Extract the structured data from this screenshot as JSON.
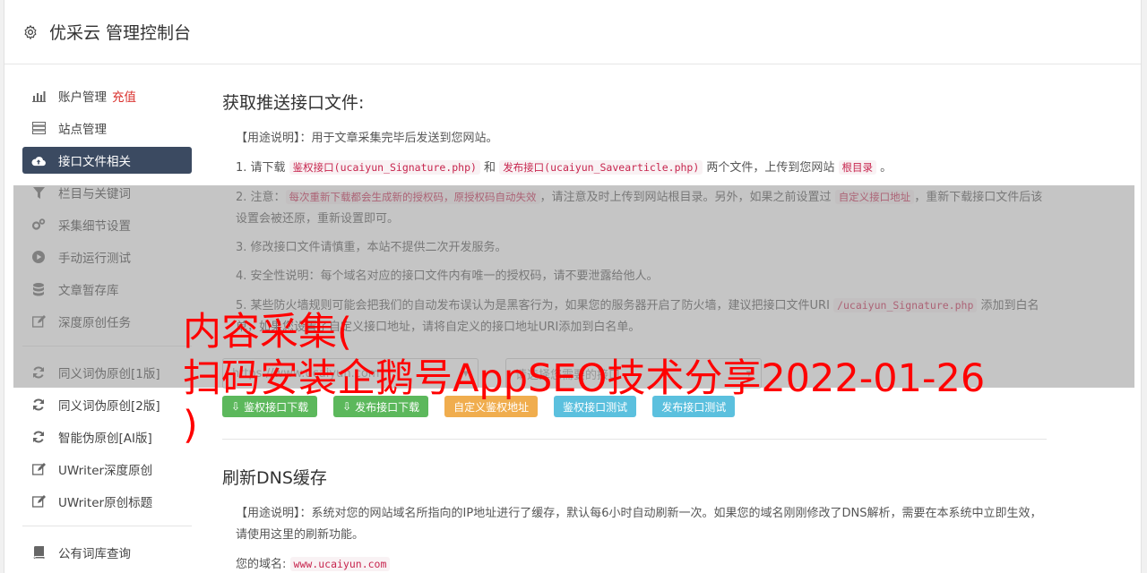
{
  "header": {
    "title": "优采云 管理控制台",
    "icon": "gear-icon"
  },
  "sidebar": {
    "group1": [
      {
        "label": "账户管理",
        "extra": "充值",
        "icon": "bar-chart-icon"
      },
      {
        "label": "站点管理",
        "icon": "server-icon"
      },
      {
        "label": "接口文件相关",
        "icon": "cloud-upload-icon",
        "active": true
      },
      {
        "label": "栏目与关键词",
        "icon": "filter-icon"
      },
      {
        "label": "采集细节设置",
        "icon": "cogs-icon"
      },
      {
        "label": "手动运行测试",
        "icon": "play-circle-icon"
      },
      {
        "label": "文章暂存库",
        "icon": "database-icon"
      },
      {
        "label": "深度原创任务",
        "icon": "edit-icon"
      }
    ],
    "group2": [
      {
        "label": "同义词伪原创[1版]",
        "icon": "refresh-icon"
      },
      {
        "label": "同义词伪原创[2版]",
        "icon": "refresh-icon"
      },
      {
        "label": "智能伪原创[AI版]",
        "icon": "refresh-icon"
      },
      {
        "label": "UWriter深度原创",
        "icon": "edit-icon"
      },
      {
        "label": "UWriter原创标题",
        "icon": "edit-icon"
      }
    ],
    "group3": [
      {
        "label": "公有词库查询",
        "icon": "book-icon"
      }
    ]
  },
  "interface": {
    "title": "获取推送接口文件:",
    "usage_label": "【用途说明】",
    "usage_text": "：用于文章采集完毕后发送到您网站。",
    "item1": {
      "prefix": "1. 请下载 ",
      "code1": "鉴权接口(ucaiyun_Signature.php)",
      "mid1": " 和 ",
      "code2": "发布接口(ucaiyun_Savearticle.php)",
      "mid2": " 两个文件，上传到您网站 ",
      "code3": "根目录",
      "suffix": " 。"
    },
    "item2": {
      "prefix": "2. 注意：",
      "code1": "每次重新下载都会生成新的授权码，原授权码自动失效",
      "mid": "，请注意及时上传到网站根目录。另外，如果之前设置过 ",
      "code2": "自定义接口地址",
      "suffix": "，重新下载接口文件后该设置会被还原，重新设置即可。"
    },
    "item3": "3. 修改接口文件请慎重，本站不提供二次开发服务。",
    "item4": "4. 安全性说明：每个域名对应的接口文件内有唯一的授权码，请不要泄露给他人。",
    "item5": {
      "prefix": "5. 某些防火墙规则可能会把我们的自动发布误认为是黑客行为，如果您的服务器开启了防火墙，建议把接口文件URI ",
      "code1": "/ucaiyun_Signature.php",
      "suffix": " 添加到白名单，如果您设置了自定义接口地址，请将自定义的接口地址URI添加到白名单。"
    },
    "site_select": "https://www.ucaiyun.com",
    "interface_select_placeholder": "请选择您需要的接口",
    "buttons": {
      "download_sign": "鉴权接口下载",
      "download_publish": "发布接口下载",
      "custom_address": "自定义鉴权地址",
      "test_sign": "鉴权接口测试",
      "test_publish": "发布接口测试"
    }
  },
  "dns": {
    "title": "刷新DNS缓存",
    "usage_label": "【用途说明】",
    "usage_text": "：系统对您的网站域名所指向的IP地址进行了缓存，默认每6小时自动刷新一次。如果您的域名刚刚修改了DNS解析，需要在本系统中立即生效，请使用这里的刷新功能。",
    "domain_label": "您的域名:",
    "domain_value": "www.ucaiyun.com"
  },
  "watermark": {
    "line1": "内容采集(",
    "line2": "扫码安装企鹅号AppSEO技术分享2022-01-26",
    "line3": ")"
  },
  "colors": {
    "active_nav": "#3b4a61",
    "accent_red": "#d9302c",
    "btn_green": "#5cb85c",
    "btn_orange": "#f0ad4e",
    "btn_blue": "#5bc0de"
  }
}
